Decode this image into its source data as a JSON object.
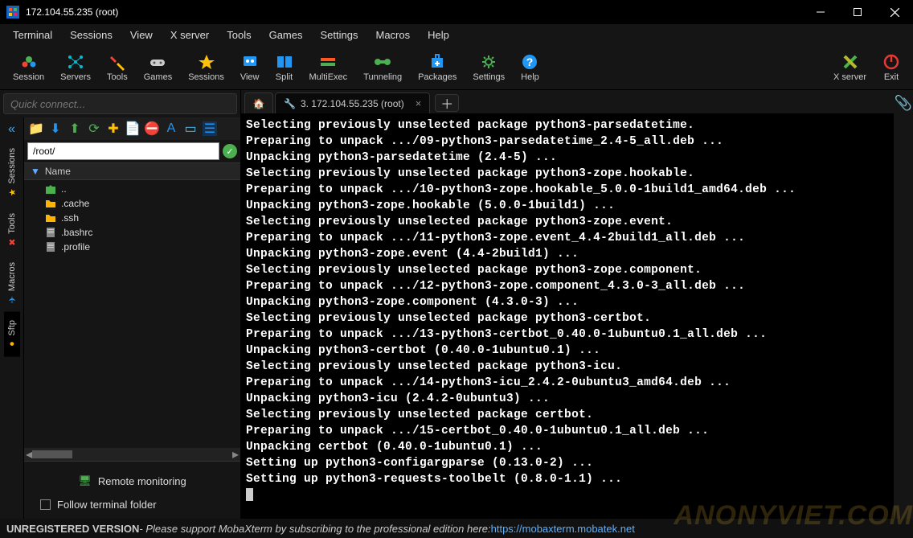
{
  "window": {
    "title": "172.104.55.235 (root)"
  },
  "menu": [
    "Terminal",
    "Sessions",
    "View",
    "X server",
    "Tools",
    "Games",
    "Settings",
    "Macros",
    "Help"
  ],
  "toolbar": [
    {
      "label": "Session",
      "icon": "session",
      "color": "#4caf50"
    },
    {
      "label": "Servers",
      "icon": "servers",
      "color": "#00bcd4"
    },
    {
      "label": "Tools",
      "icon": "tools",
      "color": "#f44336"
    },
    {
      "label": "Games",
      "icon": "games",
      "color": "#ccc"
    },
    {
      "label": "Sessions",
      "icon": "star",
      "color": "#ffc107"
    },
    {
      "label": "View",
      "icon": "view",
      "color": "#2196f3"
    },
    {
      "label": "Split",
      "icon": "split",
      "color": "#2196f3"
    },
    {
      "label": "MultiExec",
      "icon": "multi",
      "color": "#ff5722"
    },
    {
      "label": "Tunneling",
      "icon": "tunnel",
      "color": "#4caf50"
    },
    {
      "label": "Packages",
      "icon": "pkg",
      "color": "#2196f3"
    },
    {
      "label": "Settings",
      "icon": "gear",
      "color": "#4caf50"
    },
    {
      "label": "Help",
      "icon": "help",
      "color": "#2196f3"
    }
  ],
  "toolbar_right": [
    {
      "label": "X server",
      "icon": "xsrv"
    },
    {
      "label": "Exit",
      "icon": "exit",
      "color": "#e53935"
    }
  ],
  "quickconnect_placeholder": "Quick connect...",
  "vtabs": [
    {
      "label": "Sessions",
      "icon": "star"
    },
    {
      "label": "Tools",
      "icon": "wrench"
    },
    {
      "label": "Macros",
      "icon": "plane"
    },
    {
      "label": "Sftp",
      "icon": "dot"
    }
  ],
  "sftp": {
    "path": "/root/",
    "header": "Name",
    "items": [
      {
        "name": "..",
        "type": "up"
      },
      {
        "name": ".cache",
        "type": "folder"
      },
      {
        "name": ".ssh",
        "type": "folder"
      },
      {
        "name": ".bashrc",
        "type": "file"
      },
      {
        "name": ".profile",
        "type": "file"
      }
    ],
    "remote_monitoring": "Remote monitoring",
    "follow": "Follow terminal folder"
  },
  "tabs": {
    "active_label": "3. 172.104.55.235 (root)"
  },
  "terminal_lines": [
    "Selecting previously unselected package python3-parsedatetime.",
    "Preparing to unpack .../09-python3-parsedatetime_2.4-5_all.deb ...",
    "Unpacking python3-parsedatetime (2.4-5) ...",
    "Selecting previously unselected package python3-zope.hookable.",
    "Preparing to unpack .../10-python3-zope.hookable_5.0.0-1build1_amd64.deb ...",
    "Unpacking python3-zope.hookable (5.0.0-1build1) ...",
    "Selecting previously unselected package python3-zope.event.",
    "Preparing to unpack .../11-python3-zope.event_4.4-2build1_all.deb ...",
    "Unpacking python3-zope.event (4.4-2build1) ...",
    "Selecting previously unselected package python3-zope.component.",
    "Preparing to unpack .../12-python3-zope.component_4.3.0-3_all.deb ...",
    "Unpacking python3-zope.component (4.3.0-3) ...",
    "Selecting previously unselected package python3-certbot.",
    "Preparing to unpack .../13-python3-certbot_0.40.0-1ubuntu0.1_all.deb ...",
    "Unpacking python3-certbot (0.40.0-1ubuntu0.1) ...",
    "Selecting previously unselected package python3-icu.",
    "Preparing to unpack .../14-python3-icu_2.4.2-0ubuntu3_amd64.deb ...",
    "Unpacking python3-icu (2.4.2-0ubuntu3) ...",
    "Selecting previously unselected package certbot.",
    "Preparing to unpack .../15-certbot_0.40.0-1ubuntu0.1_all.deb ...",
    "Unpacking certbot (0.40.0-1ubuntu0.1) ...",
    "Setting up python3-configargparse (0.13.0-2) ...",
    "Setting up python3-requests-toolbelt (0.8.0-1.1) ..."
  ],
  "status": {
    "unreg": "UNREGISTERED VERSION",
    "msg": "  -  Please support MobaXterm by subscribing to the professional edition here:  ",
    "url": "https://mobaxterm.mobatek.net"
  },
  "watermark": "ANONYVIET.COM"
}
